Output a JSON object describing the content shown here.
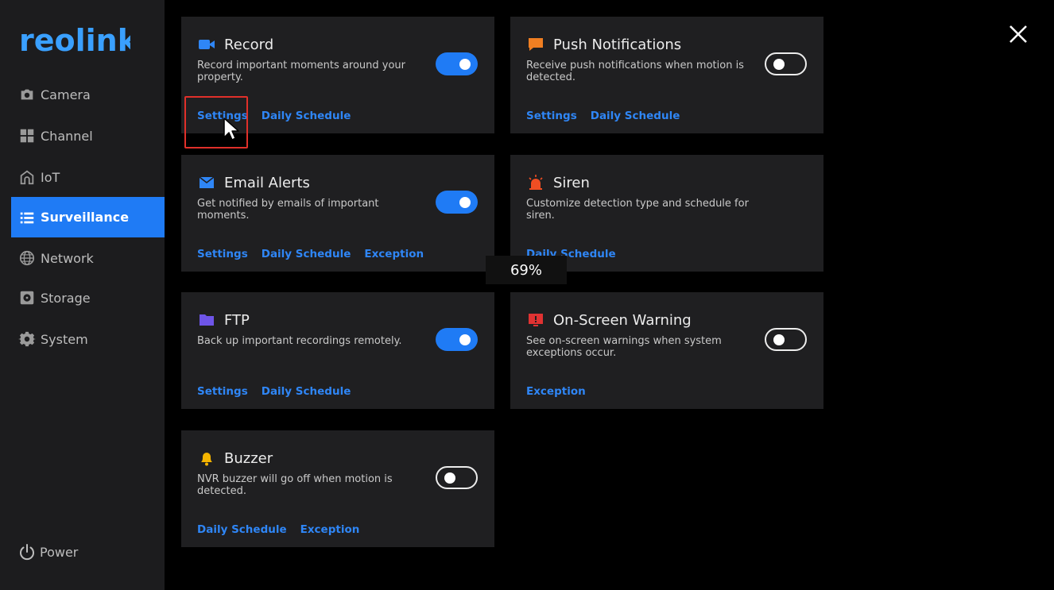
{
  "brand": {
    "logo_text": "reolink"
  },
  "sidebar": {
    "items": [
      {
        "label": "Camera",
        "icon": "camera-icon"
      },
      {
        "label": "Channel",
        "icon": "grid-icon"
      },
      {
        "label": "IoT",
        "icon": "home-icon"
      },
      {
        "label": "Surveillance",
        "icon": "list-icon",
        "active": true
      },
      {
        "label": "Network",
        "icon": "globe-icon"
      },
      {
        "label": "Storage",
        "icon": "storage-icon"
      },
      {
        "label": "System",
        "icon": "gear-icon"
      }
    ],
    "power_label": "Power"
  },
  "cards": {
    "record": {
      "title": "Record",
      "desc": "Record important moments around your property.",
      "toggle": "on",
      "links": [
        "Settings",
        "Daily Schedule"
      ]
    },
    "push": {
      "title": "Push Notifications",
      "desc": "Receive push notifications when motion is detected.",
      "toggle": "off",
      "links": [
        "Settings",
        "Daily Schedule"
      ]
    },
    "email": {
      "title": "Email Alerts",
      "desc": "Get notified by emails of important moments.",
      "toggle": "on",
      "links": [
        "Settings",
        "Daily Schedule",
        "Exception"
      ]
    },
    "siren": {
      "title": "Siren",
      "desc": "Customize detection type and schedule for siren.",
      "links": [
        "Daily Schedule"
      ]
    },
    "ftp": {
      "title": "FTP",
      "desc": "Back up important recordings remotely.",
      "toggle": "on",
      "links": [
        "Settings",
        "Daily Schedule"
      ]
    },
    "warning": {
      "title": "On-Screen Warning",
      "desc": "See on-screen warnings when system exceptions occur.",
      "toggle": "off",
      "links": [
        "Exception"
      ]
    },
    "buzzer": {
      "title": "Buzzer",
      "desc": "NVR buzzer will go off when motion is detected.",
      "toggle": "off",
      "links": [
        "Daily Schedule",
        "Exception"
      ]
    }
  },
  "zoom_level": "69%",
  "colors": {
    "accent": "#1f7bf5",
    "link": "#2f86f6",
    "card_bg": "#1f1f21",
    "sidebar_bg": "#1c1c1e",
    "highlight": "#e0302a"
  }
}
